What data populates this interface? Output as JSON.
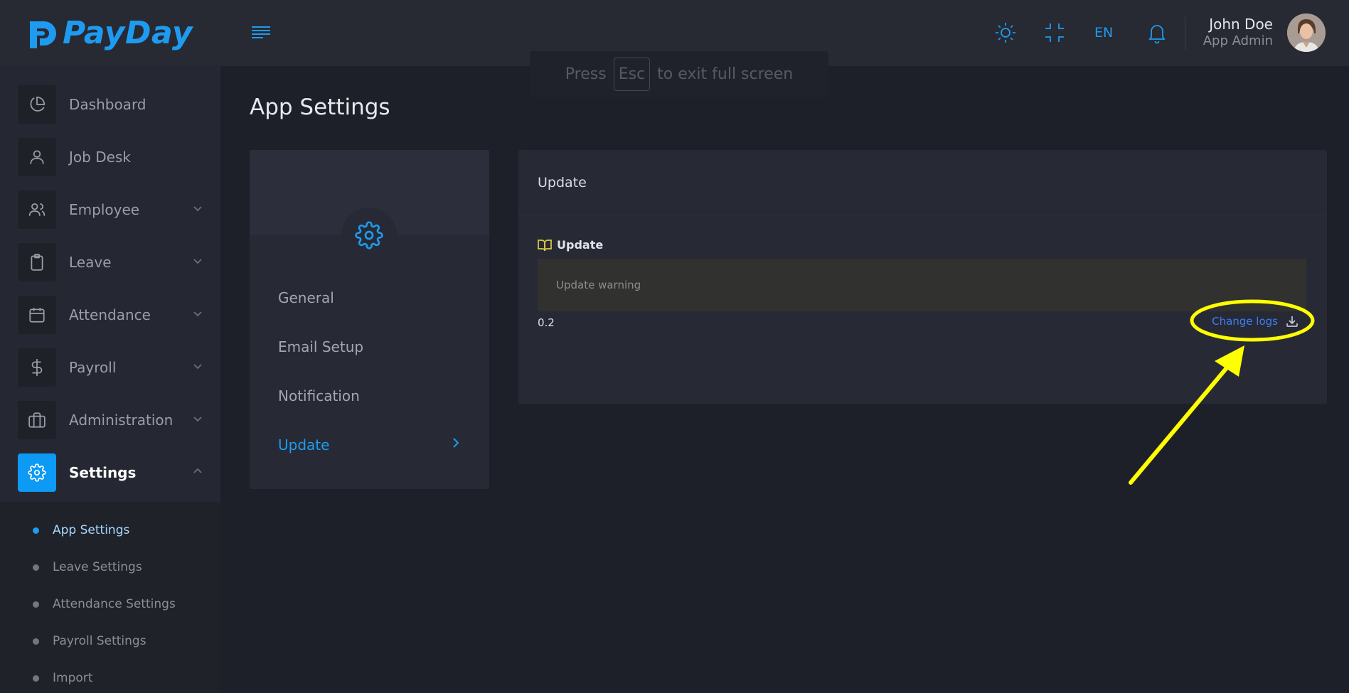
{
  "brand": {
    "name_part1": "Pay",
    "name_part2": "Day",
    "accent": "#1e9bf0"
  },
  "sidebar": {
    "items": [
      {
        "label": "Dashboard",
        "icon": "pie-chart-icon",
        "has_chevron": false
      },
      {
        "label": "Job Desk",
        "icon": "user-icon",
        "has_chevron": false
      },
      {
        "label": "Employee",
        "icon": "users-icon",
        "has_chevron": true
      },
      {
        "label": "Leave",
        "icon": "clipboard-icon",
        "has_chevron": true
      },
      {
        "label": "Attendance",
        "icon": "calendar-icon",
        "has_chevron": true
      },
      {
        "label": "Payroll",
        "icon": "dollar-icon",
        "has_chevron": true
      },
      {
        "label": "Administration",
        "icon": "briefcase-icon",
        "has_chevron": true
      },
      {
        "label": "Settings",
        "icon": "gear-icon",
        "has_chevron": true,
        "active": true
      }
    ],
    "submenu": [
      {
        "label": "App Settings",
        "active": true
      },
      {
        "label": "Leave Settings"
      },
      {
        "label": "Attendance Settings"
      },
      {
        "label": "Payroll Settings"
      },
      {
        "label": "Import"
      }
    ]
  },
  "topbar": {
    "language": "EN",
    "user_name": "John Doe",
    "user_role": "App Admin"
  },
  "fullscreen_toast": {
    "before": "Press",
    "key": "Esc",
    "after": "to exit full screen"
  },
  "page": {
    "title": "App Settings"
  },
  "settings_menu": {
    "items": [
      {
        "label": "General"
      },
      {
        "label": "Email Setup"
      },
      {
        "label": "Notification"
      },
      {
        "label": "Update",
        "active": true
      }
    ]
  },
  "update_card": {
    "header": "Update",
    "section_title": "Update",
    "warning_text": "Update warning",
    "version": "0.2",
    "change_logs_label": "Change logs"
  },
  "colors": {
    "background": "#1e2029",
    "sidebar": "#252832",
    "card": "#272a35",
    "active": "#0d9af5",
    "annotation": "#ffff00"
  }
}
